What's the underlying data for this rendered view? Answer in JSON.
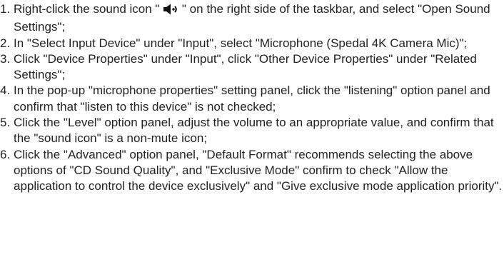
{
  "steps": [
    {
      "number": "1.",
      "before_icon": "Right-click the sound icon \" ",
      "icon": "speaker-sound-icon",
      "after_icon": " \" on the right side of the taskbar, and select \"Open Sound Settings\";"
    },
    {
      "number": "2.",
      "text": "In \"Select Input Device\" under \"Input\", select \"Microphone (Spedal 4K Camera Mic)\";"
    },
    {
      "number": "3.",
      "text": "Click \"Device Properties\" under \"Input\", click \"Other Device Properties\" under \"Related Settings\";"
    },
    {
      "number": "4.",
      "text": "In the pop-up \"microphone properties\" setting panel, click the \"listening\" option panel and confirm that \"listen to this device\" is not checked;"
    },
    {
      "number": "5.",
      "text": "Click the \"Level\" option panel, adjust the volume to an appropriate value, and confirm that the \"sound icon\" is a non-mute icon;"
    },
    {
      "number": "6.",
      "text": "Click the \"Advanced\" option panel, \"Default Format\" recommends selecting the above options of \"CD Sound Quality\", and \"Exclusive Mode\" confirm to check \"Allow the application to control the device exclusively\" and \"Give exclusive mode application priority\"."
    }
  ]
}
